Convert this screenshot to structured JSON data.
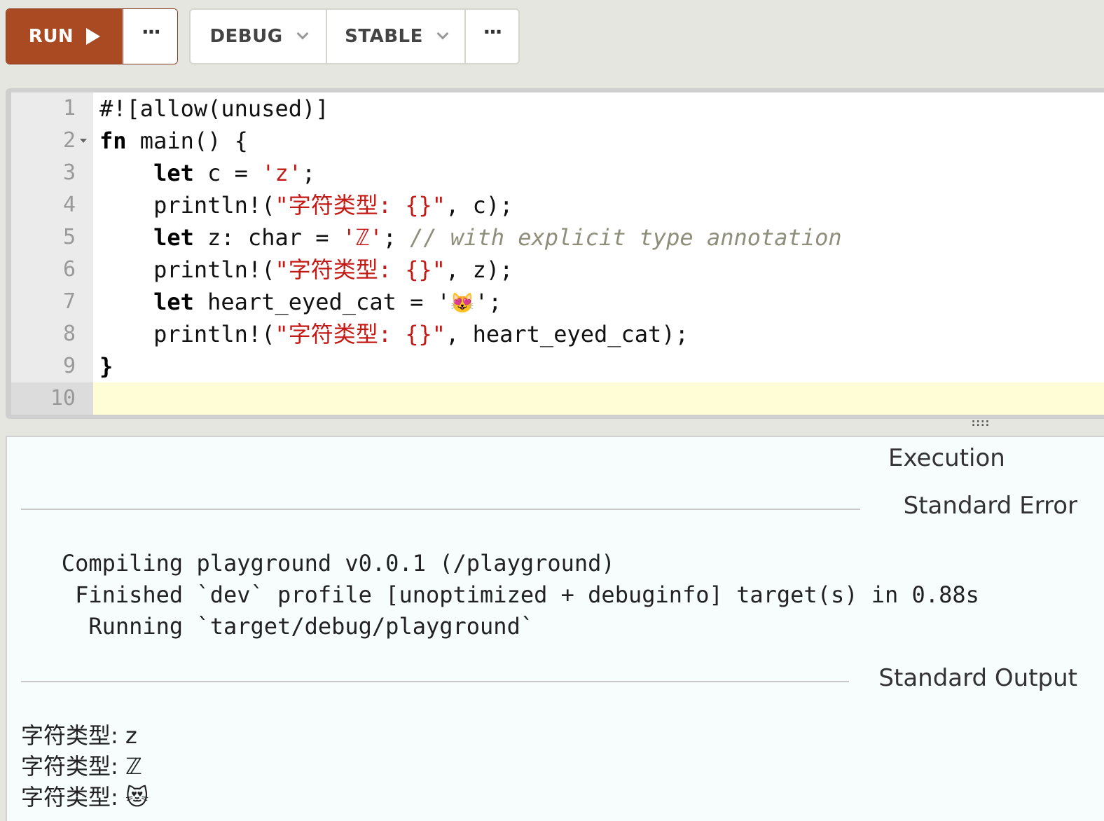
{
  "toolbar": {
    "run_label": "RUN",
    "run_more_label": "···",
    "mode_label": "DEBUG",
    "channel_label": "STABLE",
    "more_label": "···"
  },
  "editor": {
    "lines": [
      {
        "number": "1",
        "tokens": [
          {
            "t": "#![allow(unused)]"
          }
        ]
      },
      {
        "number": "2",
        "fold": true,
        "tokens": [
          {
            "t": "fn",
            "c": "kw"
          },
          {
            "t": " main() {"
          }
        ]
      },
      {
        "number": "3",
        "tokens": [
          {
            "t": "    "
          },
          {
            "t": "let",
            "c": "kw"
          },
          {
            "t": " c = "
          },
          {
            "t": "'z'",
            "c": "str"
          },
          {
            "t": ";"
          }
        ]
      },
      {
        "number": "4",
        "tokens": [
          {
            "t": "    println!("
          },
          {
            "t": "\"字符类型: {}\"",
            "c": "str"
          },
          {
            "t": ", c);"
          }
        ]
      },
      {
        "number": "5",
        "tokens": [
          {
            "t": "    "
          },
          {
            "t": "let",
            "c": "kw"
          },
          {
            "t": " z: char = "
          },
          {
            "t": "'ℤ'",
            "c": "str"
          },
          {
            "t": "; "
          },
          {
            "t": "// with explicit type annotation",
            "c": "cmt"
          }
        ]
      },
      {
        "number": "6",
        "tokens": [
          {
            "t": "    println!("
          },
          {
            "t": "\"字符类型: {}\"",
            "c": "str"
          },
          {
            "t": ", z);"
          }
        ]
      },
      {
        "number": "7",
        "tokens": [
          {
            "t": "    "
          },
          {
            "t": "let",
            "c": "kw"
          },
          {
            "t": " heart_eyed_cat = '"
          },
          {
            "t": "😻",
            "c": "emoji-code"
          },
          {
            "t": "';"
          }
        ]
      },
      {
        "number": "8",
        "tokens": [
          {
            "t": "    println!("
          },
          {
            "t": "\"字符类型: {}\"",
            "c": "str"
          },
          {
            "t": ", heart_eyed_cat);"
          }
        ]
      },
      {
        "number": "9",
        "tokens": [
          {
            "t": "}",
            "c": "kw"
          }
        ]
      },
      {
        "number": "10",
        "active": true,
        "tokens": []
      }
    ]
  },
  "output": {
    "title": "Execution",
    "stderr_label": "Standard Error",
    "stderr_text": "   Compiling playground v0.0.1 (/playground)\n    Finished `dev` profile [unoptimized + debuginfo] target(s) in 0.88s\n     Running `target/debug/playground`",
    "stdout_label": "Standard Output",
    "stdout_text": "字符类型: z\n字符类型: ℤ\n字符类型: 😻"
  },
  "colors": {
    "run_button": "#a94a23",
    "string": "#c41a16",
    "comment": "#8e8e7a",
    "active_line": "#fefdd6"
  }
}
